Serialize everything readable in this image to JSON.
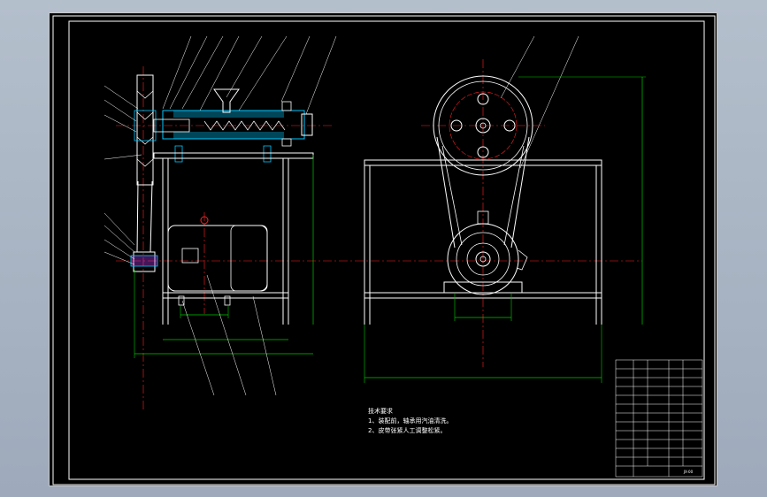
{
  "technical_requirements": {
    "title": "技术要求",
    "items": [
      "1、装配前，轴承用汽油清洗。",
      "2、皮带张紧人工调整松紧。"
    ]
  },
  "title_block": {
    "drawing_number": "JX-00"
  },
  "colors": {
    "background": "#000000",
    "outline": "#ffffff",
    "dimension": "#00c800",
    "centerline": "#ff2020",
    "section": "#00c8ff",
    "leader": "#ffffff",
    "hatch": "#c040ff"
  }
}
